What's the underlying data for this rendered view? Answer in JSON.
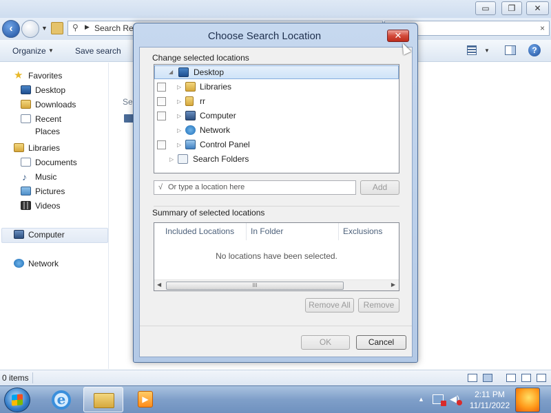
{
  "explorer": {
    "address_text": "Search Res",
    "search_clear": "×",
    "organize": "Organize",
    "save_search": "Save search",
    "content_header": "Sea",
    "status_text": "0 items",
    "window_controls": {
      "minimize": "▭",
      "maximize": "❐",
      "close": "✕"
    }
  },
  "navpane": {
    "items": [
      {
        "label": "Favorites",
        "icon": "star-icon"
      },
      {
        "label": "Desktop",
        "icon": "desktop-icon"
      },
      {
        "label": "Downloads",
        "icon": "downloads-icon"
      },
      {
        "label": "Recent Places",
        "icon": "recent-places-icon"
      },
      {
        "label": "Libraries",
        "icon": "libraries-icon"
      },
      {
        "label": "Documents",
        "icon": "documents-icon"
      },
      {
        "label": "Music",
        "icon": "music-icon"
      },
      {
        "label": "Pictures",
        "icon": "pictures-icon"
      },
      {
        "label": "Videos",
        "icon": "videos-icon"
      },
      {
        "label": "Computer",
        "icon": "computer-icon"
      },
      {
        "label": "Network",
        "icon": "network-icon"
      }
    ]
  },
  "dialog": {
    "title": "Choose Search Location",
    "close_glyph": "✕",
    "change_label": "Change selected locations",
    "tree": [
      {
        "label": "Desktop",
        "selected": true
      },
      {
        "label": "Libraries"
      },
      {
        "label": "rr"
      },
      {
        "label": "Computer"
      },
      {
        "label": "Network"
      },
      {
        "label": "Control Panel"
      },
      {
        "label": "Search Folders"
      }
    ],
    "location_placeholder": "Or type a location here",
    "location_icon": "√",
    "add_button": "Add",
    "summary_label": "Summary of selected locations",
    "columns": [
      "Included Locations",
      "In Folder",
      "Exclusions"
    ],
    "empty_message": "No locations have been selected.",
    "scroll_thumb_grip": "III",
    "remove_all_button": "Remove All",
    "remove_button": "Remove",
    "ok_button": "OK",
    "cancel_button": "Cancel"
  },
  "taskbar": {
    "ie_glyph": "e",
    "wmp_glyph": "▶",
    "time": "2:11 PM",
    "date": "11/11/2022"
  }
}
